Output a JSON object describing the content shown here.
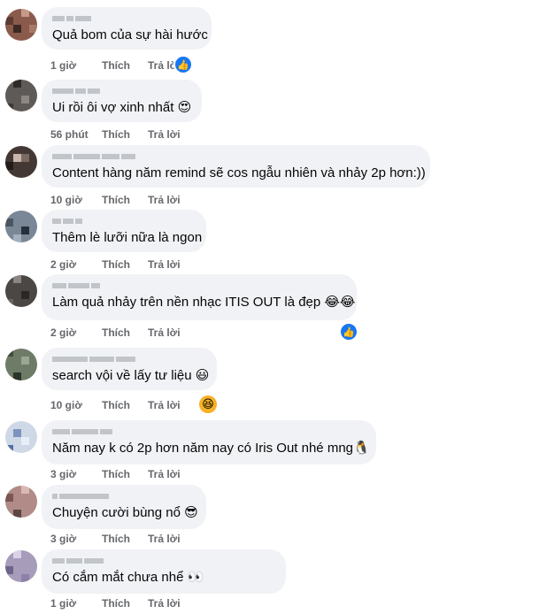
{
  "comments": [
    {
      "text": "Quả bom của sự hài hước",
      "time": "1 giờ",
      "like": "Thích",
      "reply": "Trả lời",
      "reaction": "like"
    },
    {
      "text": "Ui rồi ôi vợ xinh nhất 😍",
      "time": "56 phút",
      "like": "Thích",
      "reply": "Trả lời"
    },
    {
      "text": "Content hàng năm remind sẽ cos ngẫu nhiên và nhảy 2p hơn:))",
      "time": "10 giờ",
      "like": "Thích",
      "reply": "Trả lời"
    },
    {
      "text": "Thêm lè lưỡi nữa là ngon",
      "time": "2 giờ",
      "like": "Thích",
      "reply": "Trả lời"
    },
    {
      "text": "Làm quả nhảy trên nền nhạc ITIS OUT là đẹp 😂😂",
      "time": "2 giờ",
      "like": "Thích",
      "reply": "Trả lời",
      "reaction": "like"
    },
    {
      "text": "search vội về lấy tư liệu 😃",
      "time": "10 giờ",
      "like": "Thích",
      "reply": "Trả lời",
      "reaction": "haha"
    },
    {
      "text": "Năm nay k có 2p hơn năm nay có Iris Out nhé mng🐧",
      "time": "3 giờ",
      "like": "Thích",
      "reply": "Trả lời"
    },
    {
      "text": "Chuyện cười bùng nổ 😎",
      "time": "3 giờ",
      "like": "Thích",
      "reply": "Trả lời"
    },
    {
      "text": "Có            cắm mắt chưa nhể 👀",
      "time": "1 giờ",
      "like": "Thích",
      "reply": "Trả lời"
    }
  ],
  "colors": {
    "bubble": "#f0f2f5",
    "meta": "#65676b",
    "like_blue": "#1877f2"
  },
  "icons": {
    "like_reaction": "thumbs-up-icon",
    "haha_reaction": "grinning-face-icon"
  }
}
